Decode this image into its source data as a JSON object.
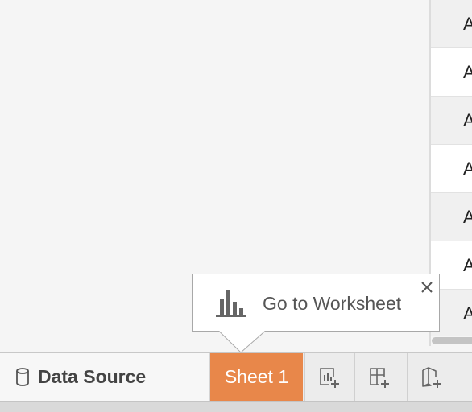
{
  "grid": {
    "rows": [
      "A",
      "A",
      "A",
      "A",
      "A",
      "A",
      "A"
    ]
  },
  "tabs": {
    "data_source_label": "Data Source",
    "sheet_label": "Sheet 1"
  },
  "tooltip": {
    "text": "Go to Worksheet"
  },
  "icons": {
    "data_source": "database-icon",
    "new_worksheet": "new-worksheet-icon",
    "new_dashboard": "new-dashboard-icon",
    "new_story": "new-story-icon",
    "tooltip": "bar-chart-icon",
    "close": "close-icon"
  },
  "colors": {
    "active_tab": "#e8874a",
    "background": "#f5f5f5"
  }
}
